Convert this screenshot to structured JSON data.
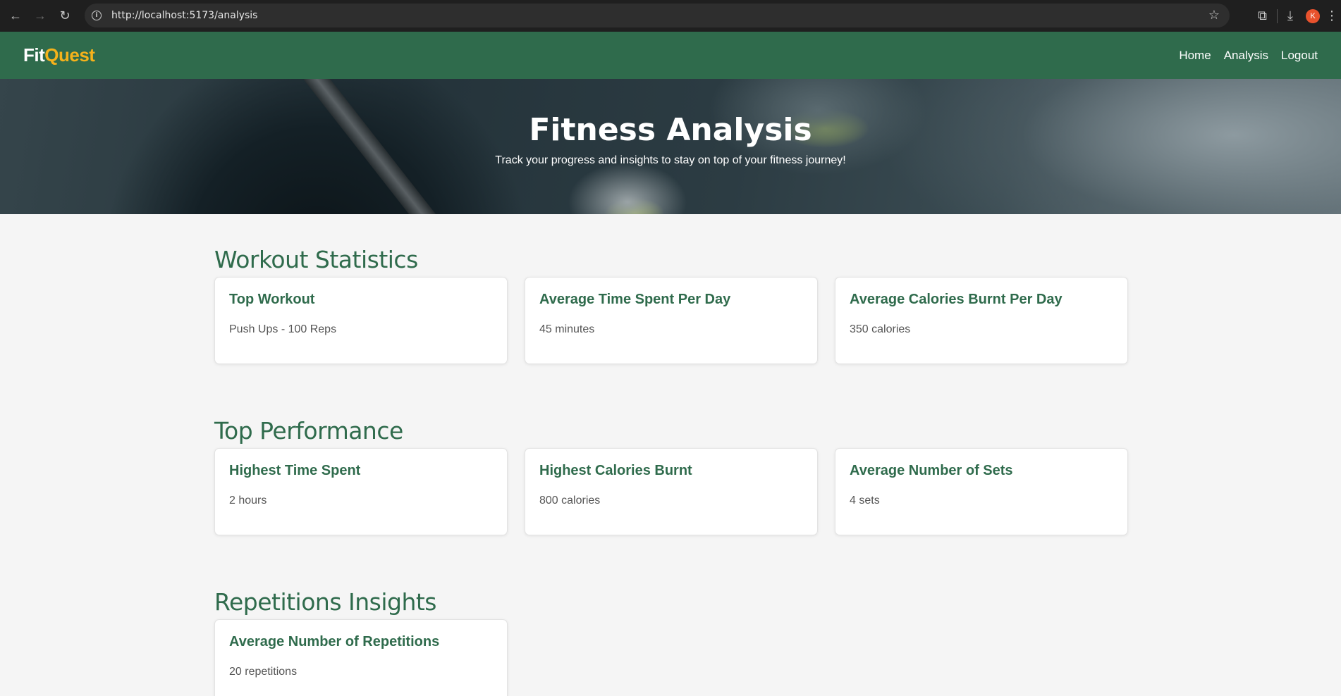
{
  "browser": {
    "url": "http://localhost:5173/analysis",
    "avatar_initial": "K",
    "icons": [
      "back-icon",
      "forward-icon",
      "reload-icon",
      "info-icon",
      "star-icon",
      "extensions-icon",
      "download-icon",
      "menu-icon"
    ]
  },
  "navbar": {
    "brand_fit": "Fit",
    "brand_quest": "Quest",
    "links": [
      "Home",
      "Analysis",
      "Logout"
    ]
  },
  "hero": {
    "title": "Fitness Analysis",
    "subtitle": "Track your progress and insights to stay on top of your fitness journey!"
  },
  "sections": [
    {
      "title": "Workout Statistics",
      "cards": [
        {
          "title": "Top Workout",
          "value": "Push Ups - 100 Reps"
        },
        {
          "title": "Average Time Spent Per Day",
          "value": "45 minutes"
        },
        {
          "title": "Average Calories Burnt Per Day",
          "value": "350 calories"
        }
      ]
    },
    {
      "title": "Top Performance",
      "cards": [
        {
          "title": "Highest Time Spent",
          "value": "2 hours"
        },
        {
          "title": "Highest Calories Burnt",
          "value": "800 calories"
        },
        {
          "title": "Average Number of Sets",
          "value": "4 sets"
        }
      ]
    },
    {
      "title": "Repetitions Insights",
      "cards": [
        {
          "title": "Average Number of Repetitions",
          "value": "20 repetitions"
        }
      ]
    }
  ],
  "colors": {
    "primary": "#2f6b4c",
    "brand_accent": "#f5b21b",
    "page_background": "#f5f5f5",
    "card_background": "#ffffff"
  }
}
